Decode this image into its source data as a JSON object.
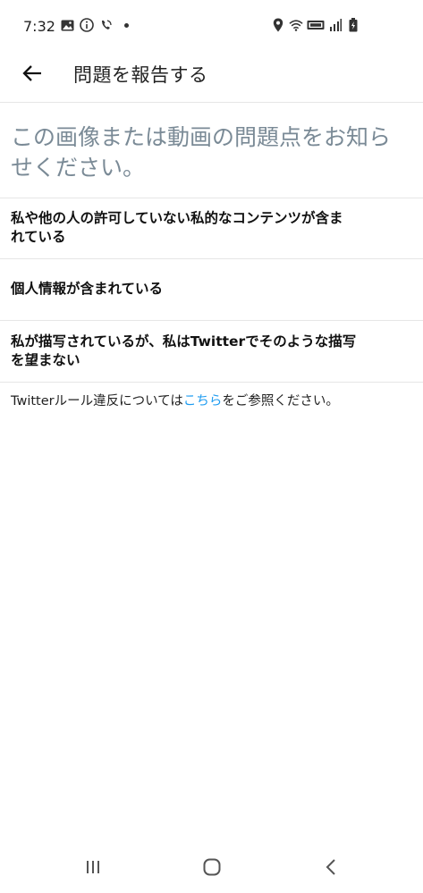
{
  "status_bar": {
    "time": "7:32",
    "icons_left": [
      "image-icon",
      "info-icon",
      "wifi-calling-icon",
      "dot-icon"
    ],
    "icons_right": [
      "location-icon",
      "wifi-icon",
      "volte-icon",
      "signal-icon",
      "battery-icon"
    ]
  },
  "header": {
    "title": "問題を報告する",
    "back_icon": "arrow-left-icon"
  },
  "prompt": {
    "line1": "この画像または動画の問題点をお知ら",
    "line2": "せください。"
  },
  "options": [
    {
      "line1": "私や他の人の許可していない私的なコンテンツが含ま",
      "line2": "れている"
    },
    {
      "line1": "個人情報が含まれている"
    },
    {
      "line1": "私が描写されているが、私はTwitterでそのような描写",
      "line2": "を望まない"
    }
  ],
  "rules": {
    "prefix": "Twitterルール違反については",
    "link": "こちら",
    "suffix": "をご参照ください。",
    "link_color": "#1d9bf0"
  },
  "nav_bar": {
    "icons": [
      "recent-apps-icon",
      "home-icon",
      "back-icon"
    ]
  }
}
